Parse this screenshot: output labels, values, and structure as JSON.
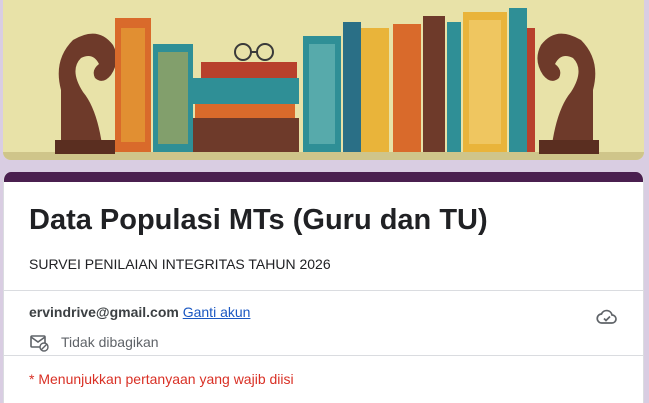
{
  "header": {
    "banner_image": "bookshelf-illustration",
    "colors": {
      "background": "#e8e2a8",
      "bookend": "#6e3a2a",
      "teal": "#2f8f96",
      "orange": "#d96a2b",
      "yellow": "#e9b43a",
      "red": "#b8402c"
    }
  },
  "form": {
    "title": "Data Populasi MTs (Guru dan TU)",
    "subtitle": "SURVEI PENILAIAN INTEGRITAS TAHUN 2026",
    "accent_color": "#4a1f4f",
    "account": {
      "email": "ervindrive@gmail.com",
      "switch_label": "Ganti akun",
      "share_status": "Tidak dibagikan",
      "share_icon": "mail-off-icon",
      "cloud_icon": "cloud-saved-icon"
    },
    "required_note": "* Menunjukkan pertanyaan yang wajib diisi",
    "required_color": "#d93025"
  }
}
